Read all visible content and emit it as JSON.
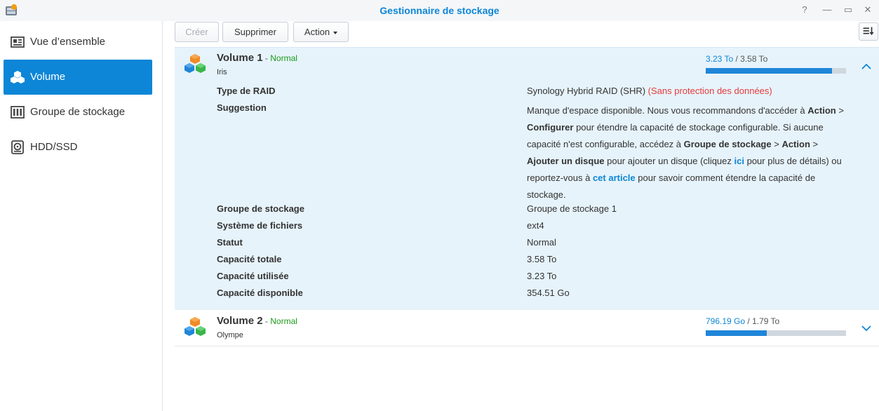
{
  "window": {
    "title": "Gestionnaire de stockage",
    "controls": [
      "?",
      "—",
      "▭",
      "✕"
    ]
  },
  "sidebar": {
    "items": [
      {
        "label": "Vue d’ensemble",
        "icon": "overview-icon",
        "active": false
      },
      {
        "label": "Volume",
        "icon": "volume-icon",
        "active": true
      },
      {
        "label": "Groupe de stockage",
        "icon": "storage-pool-icon",
        "active": false
      },
      {
        "label": "HDD/SSD",
        "icon": "disk-icon",
        "active": false
      }
    ]
  },
  "toolbar": {
    "create_label": "Créer",
    "delete_label": "Supprimer",
    "action_label": "Action",
    "sort_icon": "sort-icon"
  },
  "volumes": [
    {
      "name": "Volume 1",
      "separator": " - ",
      "status": "Normal",
      "subtitle": "Iris",
      "used": "3.23 To",
      "slash": " / ",
      "total": "3.58 To",
      "usage_fraction": 0.902,
      "expanded": true,
      "details": {
        "raid_label": "Type de RAID",
        "raid_value": "Synology Hybrid RAID (SHR)",
        "raid_warning": "(Sans protection des données)",
        "suggestion_label": "Suggestion",
        "suggestion": {
          "t1": "Manque d'espace disponible. Nous vous recommandons d'accéder à ",
          "b1": "Action",
          "t2": " > ",
          "b2": "Configurer",
          "t3": " pour étendre la capacité de stockage configurable. Si aucune capacité n'est configurable, accédez à ",
          "b3": "Groupe de stockage",
          "t4": " > ",
          "b4": "Action",
          "t5": " > ",
          "b5": "Ajouter un disque",
          "t6": " pour ajouter un disque (cliquez ",
          "link1": "ici",
          "t7": " pour plus de détails) ou reportez-vous à ",
          "link2": "cet article",
          "t8": " pour savoir comment étendre la capacité de stockage."
        },
        "pool_label": "Groupe de stockage",
        "pool_value": "Groupe de stockage 1",
        "fs_label": "Système de fichiers",
        "fs_value": "ext4",
        "status_label": "Statut",
        "status_value": "Normal",
        "total_label": "Capacité totale",
        "total_value": "3.58 To",
        "used_label": "Capacité utilisée",
        "used_value": "3.23 To",
        "free_label": "Capacité disponible",
        "free_value": "354.51 Go"
      }
    },
    {
      "name": "Volume 2",
      "separator": " - ",
      "status": "Normal",
      "subtitle": "Olympe",
      "used": "796.19 Go",
      "slash": " / ",
      "total": "1.79 To",
      "usage_fraction": 0.434,
      "expanded": false
    }
  ],
  "colors": {
    "accent": "#0d86d7",
    "status_normal": "#1a9b1a",
    "warning": "#e53b3b",
    "expanded_bg": "#e6f3fb"
  }
}
